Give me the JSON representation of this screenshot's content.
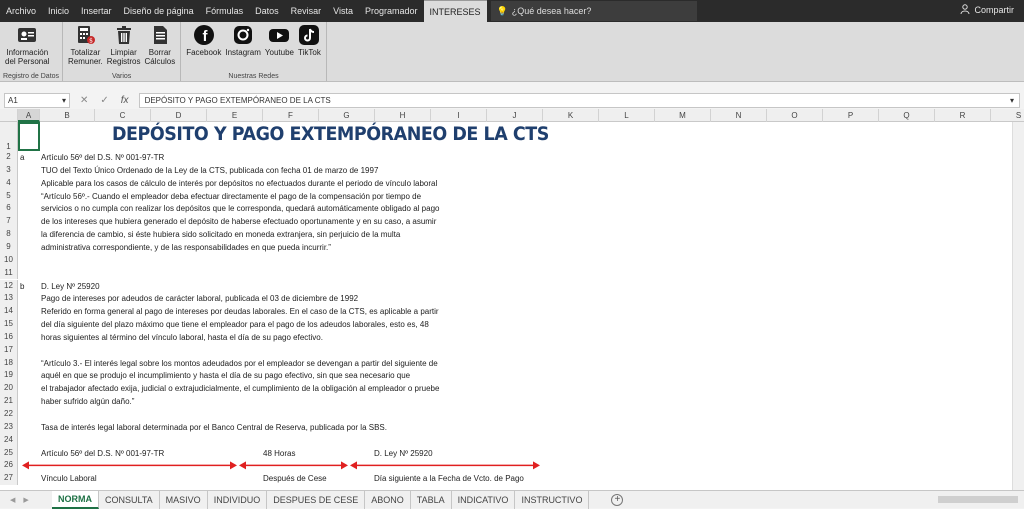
{
  "tabs": [
    "Archivo",
    "Inicio",
    "Insertar",
    "Diseño de página",
    "Fórmulas",
    "Datos",
    "Revisar",
    "Vista",
    "Programador",
    "INTERESES"
  ],
  "tellme": "¿Qué desea hacer?",
  "share": "Compartir",
  "ribbon": {
    "groups": [
      {
        "label": "Registro de Datos",
        "buttons": [
          {
            "line1": "Información",
            "line2": "del Personal"
          }
        ]
      },
      {
        "label": "Varios",
        "buttons": [
          {
            "line1": "Totalizar",
            "line2": "Remuner."
          },
          {
            "line1": "Limpiar",
            "line2": "Registros"
          },
          {
            "line1": "Borrar",
            "line2": "Cálculos"
          }
        ]
      },
      {
        "label": "Nuestras Redes",
        "buttons": [
          {
            "line1": "Facebook",
            "line2": ""
          },
          {
            "line1": "Instagram",
            "line2": ""
          },
          {
            "line1": "Youtube",
            "line2": ""
          },
          {
            "line1": "TikTok",
            "line2": ""
          }
        ]
      }
    ]
  },
  "formula_bar": {
    "namebox": "A1",
    "fx": "fx",
    "formula": "DEPÓSITO Y PAGO EXTEMPÓRANEO DE LA CTS"
  },
  "columns": [
    "A",
    "B",
    "C",
    "D",
    "E",
    "F",
    "G",
    "H",
    "I",
    "J",
    "K",
    "L",
    "M",
    "N",
    "O",
    "P",
    "Q",
    "R",
    "S"
  ],
  "sheet": {
    "title": "DEPÓSITO Y PAGO EXTEMPÓRANEO DE LA CTS",
    "rows": [
      {
        "n": "1"
      },
      {
        "n": "2",
        "a": "a",
        "b": "Artículo 56º del D.S. Nº 001-97-TR"
      },
      {
        "n": "3",
        "b": "TUO del Texto Único Ordenado de la Ley de la CTS, publicada con fecha 01 de marzo de 1997"
      },
      {
        "n": "4",
        "b": "Aplicable para los casos de cálculo de interés por depósitos no efectuados durante el periodo de vínculo laboral"
      },
      {
        "n": "5",
        "b": "“Artículo 56º.- Cuando el empleador deba efectuar directamente el pago de la compensación por tiempo de"
      },
      {
        "n": "6",
        "b": "servicios o no cumpla con realizar los depósitos que le corresponda, quedará automáticamente obligado al pago"
      },
      {
        "n": "7",
        "b": "de los intereses que hubiera generado el depósito de haberse efectuado oportunamente y en su caso, a asumir"
      },
      {
        "n": "8",
        "b": "la diferencia de cambio, si éste hubiera sido solicitado en moneda extranjera, sin perjuicio de la multa"
      },
      {
        "n": "9",
        "b": "administrativa correspondiente, y de las responsabilidades en que pueda incurrir.”"
      },
      {
        "n": "10"
      },
      {
        "n": "11"
      },
      {
        "n": "12",
        "a": "b",
        "b": "D. Ley Nº 25920"
      },
      {
        "n": "13",
        "b": "Pago de intereses por adeudos de carácter laboral, publicada el 03 de diciembre de 1992"
      },
      {
        "n": "14",
        "b": "Referido en forma general al pago de intereses por deudas laborales. En el caso de la CTS, es aplicable a partir"
      },
      {
        "n": "15",
        "b": "del día siguiente del plazo máximo que tiene el empleador para el pago de los adeudos laborales, esto es, 48"
      },
      {
        "n": "16",
        "b": "horas siguientes al término del vínculo laboral, hasta el día de su pago efectivo."
      },
      {
        "n": "17"
      },
      {
        "n": "18",
        "b": "“Artículo 3.- El interés legal sobre los montos adeudados por el empleador se devengan a partir del siguiente de"
      },
      {
        "n": "19",
        "b": "aquél en que se produjo el incumplimiento y hasta el día de su pago efectivo, sin que sea necesario que"
      },
      {
        "n": "20",
        "b": "el trabajador afectado exija, judicial o extrajudicialmente, el cumplimiento de la obligación al empleador o pruebe"
      },
      {
        "n": "21",
        "b": "haber sufrido algún daño.”"
      },
      {
        "n": "22"
      },
      {
        "n": "23",
        "b": "Tasa de interés legal laboral determinada por el Banco Central de Reserva, publicada por la SBS."
      },
      {
        "n": "24"
      },
      {
        "n": "25",
        "b": "Artículo 56º del D.S. Nº 001-97-TR",
        "f": "48 Horas",
        "h": "D. Ley Nº 25920"
      },
      {
        "n": "26"
      },
      {
        "n": "27",
        "b": "Vínculo Laboral",
        "f": "Después de Cese",
        "h": "Día siguiente a la Fecha de Vcto. de Pago"
      }
    ]
  },
  "sheet_tabs": [
    "NORMA",
    "CONSULTA",
    "MASIVO",
    "INDIVIDUO",
    "DESPUES DE CESE",
    "ABONO",
    "TABLA",
    "INDICATIVO",
    "INSTRUCTIVO"
  ],
  "colors": {
    "title": "#1f3f6e",
    "arrow": "#e02020",
    "active_sheet": "#1e7145"
  }
}
